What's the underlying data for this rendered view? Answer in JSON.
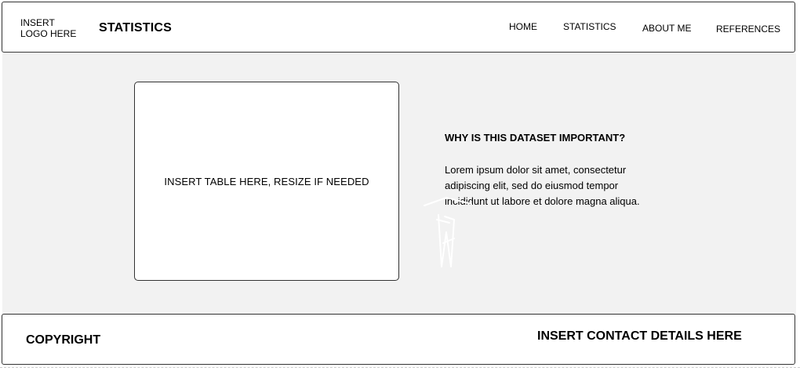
{
  "header": {
    "logo_text": "INSERT\nLOGO HERE",
    "site_title": "STATISTICS",
    "nav": {
      "home": "HOME",
      "statistics": "STATISTICS",
      "about": "ABOUT ME",
      "references": "REFERENCES"
    }
  },
  "main": {
    "table_placeholder": "INSERT TABLE HERE, RESIZE IF NEEDED",
    "why_heading": "WHY IS THIS DATASET IMPORTANT?",
    "why_body": "Lorem ipsum dolor sit amet, consectetur\nadipiscing elit, sed do eiusmod tempor\nincididunt ut labore et dolore magna aliqua."
  },
  "footer": {
    "copyright": "COPYRIGHT",
    "contact": "INSERT CONTACT DETAILS HERE"
  },
  "colors": {
    "background": "#f2f2f2",
    "panel": "#ffffff",
    "border": "#333333",
    "text": "#000000"
  }
}
